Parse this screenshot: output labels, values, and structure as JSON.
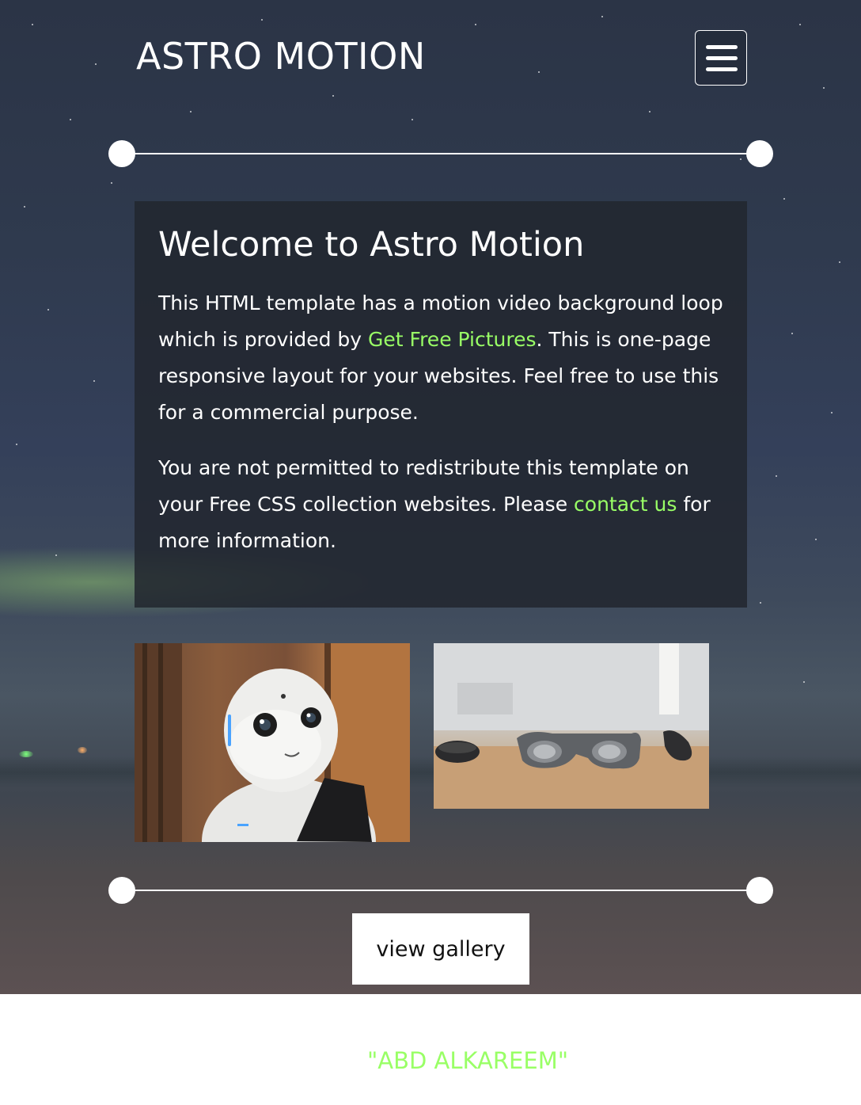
{
  "header": {
    "brand": "ASTRO MOTION",
    "menu_icon": "hamburger-menu-icon"
  },
  "welcome": {
    "title": "Welcome to Astro Motion",
    "paragraph1": {
      "before_link": "This HTML template has a motion video background loop which is provided by ",
      "link": "Get Free Pictures",
      "after_link": ". This is one-page responsive layout for your websites. Feel free to use this for a commercial purpose."
    },
    "paragraph2": {
      "before_link": "You are not permitted to redistribute this template on your Free CSS collection websites. Please ",
      "link": "contact us",
      "after_link": " for more information."
    }
  },
  "gallery": {
    "images": [
      {
        "subject": "robot"
      },
      {
        "subject": "ar-headset"
      }
    ],
    "button_label": "view gallery"
  },
  "footer": {
    "name": "\"ABD ALKAREEM\""
  },
  "colors": {
    "accent": "#99ff66",
    "panel": "#22262e",
    "text": "#ffffff"
  }
}
